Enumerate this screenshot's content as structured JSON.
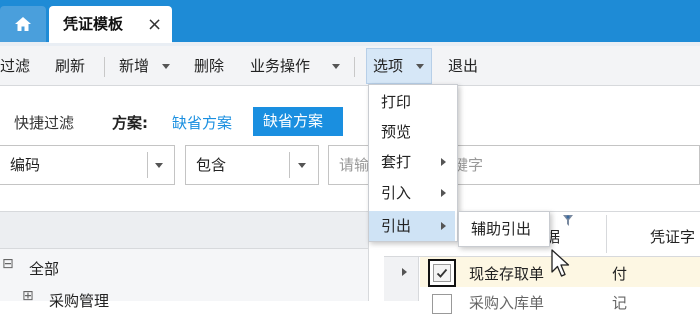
{
  "tabs": {
    "home_icon": "home-icon",
    "active_tab": "凭证模板",
    "close_glyph": "×"
  },
  "toolbar": {
    "filter": "过滤",
    "refresh": "刷新",
    "new": "新增",
    "delete": "删除",
    "business_ops": "业务操作",
    "options": "选项",
    "exit": "退出"
  },
  "quick_filter": {
    "label": "快捷过滤",
    "scheme_label": "方案:",
    "scheme_link": "缺省方案",
    "scheme_active": "缺省方案"
  },
  "filter_row": {
    "field": "编码",
    "operator": "包含",
    "keyword_left": "请输",
    "keyword_right": "键字"
  },
  "options_menu": {
    "items": [
      "打印",
      "预览",
      "套打",
      "引入",
      "引出"
    ],
    "submenu_items": [
      "辅助引出"
    ]
  },
  "tree": {
    "root": "全部",
    "child_partial": "采购管理",
    "expand_glyph": "⊟",
    "child_glyph": "⊞"
  },
  "grid": {
    "col_partial": "据",
    "col_voucher_word": "凭证字",
    "row1_name": "现金存取单",
    "row1_word": "付",
    "row2_name": "采购入库单",
    "row2_word": "记"
  },
  "colors": {
    "tab_bar": "#1e8bd6",
    "accent_blue": "#1a8fe0",
    "scheme_active_bg": "#1a8fe0",
    "menu_highlight": "#cfe3f5",
    "row_highlight": "#fdf7e3"
  }
}
